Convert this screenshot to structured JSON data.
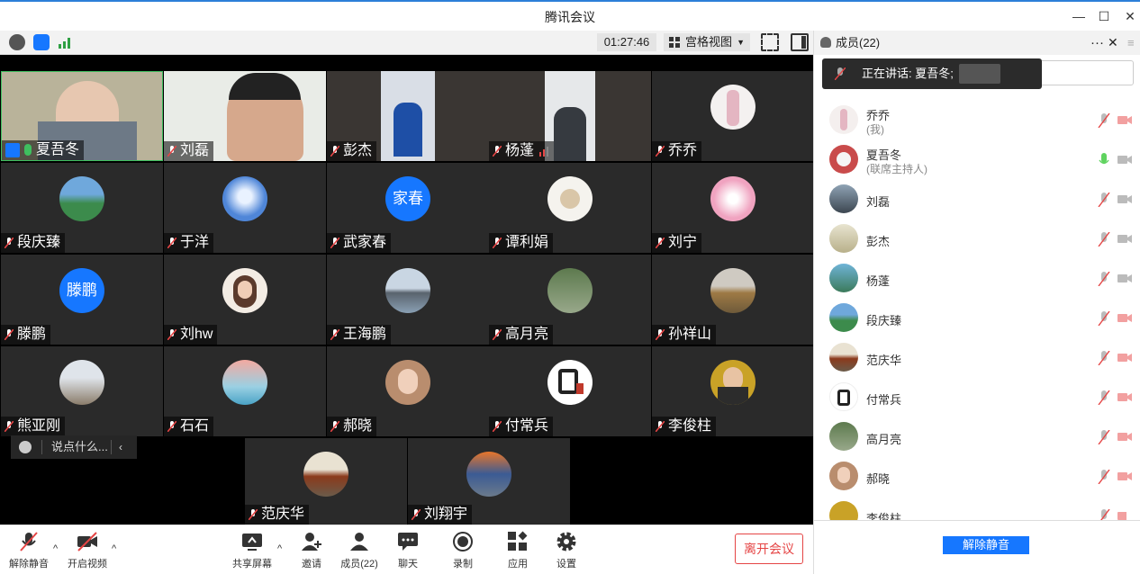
{
  "window": {
    "title": "腾讯会议"
  },
  "toolbar": {
    "timer": "01:27:46",
    "view_label": "宫格视图"
  },
  "tiles": [
    {
      "name": "夏吾冬"
    },
    {
      "name": "刘磊"
    },
    {
      "name": "彭杰"
    },
    {
      "name": "杨蓬"
    },
    {
      "name": "乔乔"
    },
    {
      "name": "段庆臻"
    },
    {
      "name": "于洋"
    },
    {
      "name": "武家春",
      "avatar_text": "家春"
    },
    {
      "name": "谭利娟"
    },
    {
      "name": "刘宁"
    },
    {
      "name": "滕鹏",
      "avatar_text": "滕鹏"
    },
    {
      "name": "刘hw"
    },
    {
      "name": "王海鹏"
    },
    {
      "name": "高月亮"
    },
    {
      "name": "孙祥山"
    },
    {
      "name": "熊亚刚"
    },
    {
      "name": "石石"
    },
    {
      "name": "郝晓"
    },
    {
      "name": "付常兵"
    },
    {
      "name": "李俊柱"
    },
    {
      "name": "范庆华"
    },
    {
      "name": "刘翔宇"
    }
  ],
  "chat": {
    "placeholder": "说点什么..."
  },
  "controls": {
    "unmute": "解除静音",
    "start_video": "开启视频",
    "share": "共享屏幕",
    "invite": "邀请",
    "members": "成员(22)",
    "chat": "聊天",
    "record": "录制",
    "apps": "应用",
    "settings": "设置",
    "leave": "离开会议"
  },
  "panel": {
    "title": "成员(22)",
    "speaking": "正在讲话: 夏吾冬;",
    "members": [
      {
        "name": "乔乔",
        "sub": "(我)"
      },
      {
        "name": "夏吾冬",
        "sub": "(联席主持人)"
      },
      {
        "name": "刘磊"
      },
      {
        "name": "彭杰"
      },
      {
        "name": "杨蓬"
      },
      {
        "name": "段庆臻"
      },
      {
        "name": "范庆华"
      },
      {
        "name": "付常兵"
      },
      {
        "name": "高月亮"
      },
      {
        "name": "郝晓"
      },
      {
        "name": "李俊柱"
      }
    ],
    "unmute_all": "解除静音"
  },
  "colors": {
    "accent": "#1677ff",
    "leave": "#e54545",
    "stage": "#000000",
    "tile": "#2a2a2a"
  }
}
